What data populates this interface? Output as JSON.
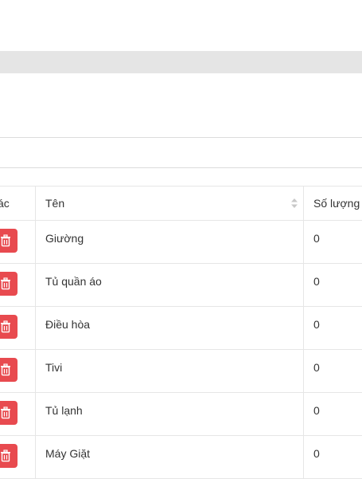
{
  "table": {
    "columns": {
      "actions_partial": "ác",
      "name": "Tên",
      "quantity_partial": "Số lượng"
    },
    "rows": [
      {
        "name": "Giường",
        "quantity": "0"
      },
      {
        "name": "Tủ quần áo",
        "quantity": "0"
      },
      {
        "name": "Điều hòa",
        "quantity": "0"
      },
      {
        "name": "Tivi",
        "quantity": "0"
      },
      {
        "name": "Tủ lạnh",
        "quantity": "0"
      },
      {
        "name": "Máy Giặt",
        "quantity": "0"
      }
    ],
    "colors": {
      "delete_button": "#e84a4f",
      "band": "#e5e5e5"
    },
    "icons": {
      "delete": "trash-icon",
      "sort": "sort-icon"
    }
  }
}
